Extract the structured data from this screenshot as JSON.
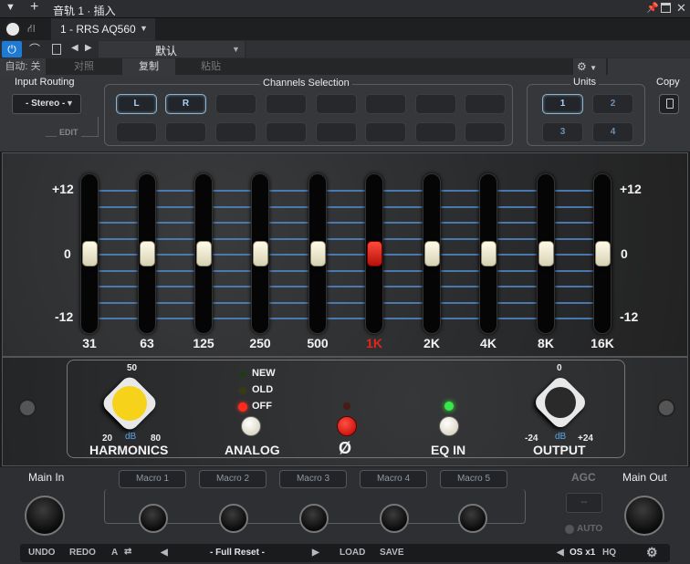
{
  "titlebar": {
    "title": "音轨 1 · 插入"
  },
  "track": {
    "name": "1 - RRS AQ560",
    "preset": "默认"
  },
  "toolbar": {
    "auto_label": "自动: 关",
    "compare_label": "对照",
    "copy_label": "复制",
    "paste_label": "粘贴"
  },
  "routing": {
    "input_routing_label": "Input Routing",
    "input_value": "- Stereo -",
    "edit_label": "EDIT",
    "channels_label": "Channels Selection",
    "channel_l": "L",
    "channel_r": "R",
    "units_label": "Units",
    "unit_1": "1",
    "unit_2": "2",
    "unit_3": "3",
    "unit_4": "4",
    "copy_label": "Copy"
  },
  "eq": {
    "scale_top": "+12",
    "scale_mid": "0",
    "scale_bottom": "-12",
    "bands": [
      "31",
      "63",
      "125",
      "250",
      "500",
      "1K",
      "2K",
      "4K",
      "8K",
      "16K"
    ],
    "band_gains_db": [
      0,
      0,
      0,
      0,
      0,
      0,
      0,
      0,
      0,
      0
    ],
    "selected_band": "1K"
  },
  "controls": {
    "harmonics_label": "HARMONICS",
    "harmonics_max": "50",
    "harmonics_min": "20",
    "harmonics_unit": "dB",
    "harmonics_end": "80",
    "analog_label": "ANALOG",
    "mode_new": "NEW",
    "mode_old": "OLD",
    "mode_off": "OFF",
    "phase_symbol": "Ø",
    "eq_in_label": "EQ IN",
    "output_label": "OUTPUT",
    "output_zero": "0",
    "output_min": "-24",
    "output_unit": "dB",
    "output_max": "+24"
  },
  "bottom": {
    "main_in": "Main In",
    "main_out": "Main Out",
    "agc": "AGC",
    "agc_value": "--",
    "auto": "AUTO",
    "macros": [
      "Macro 1",
      "Macro 2",
      "Macro 3",
      "Macro 4",
      "Macro 5"
    ]
  },
  "footer": {
    "undo": "UNDO",
    "redo": "REDO",
    "a": "A",
    "preset_name": "- Full Reset -",
    "load": "LOAD",
    "save": "SAVE",
    "os": "OS x1",
    "hq": "HQ"
  },
  "colors": {
    "accent_blue": "#4f86c6",
    "selected_red": "#e8231a",
    "harmonics_yellow": "#f7d21a",
    "led_green": "#39e84a"
  }
}
